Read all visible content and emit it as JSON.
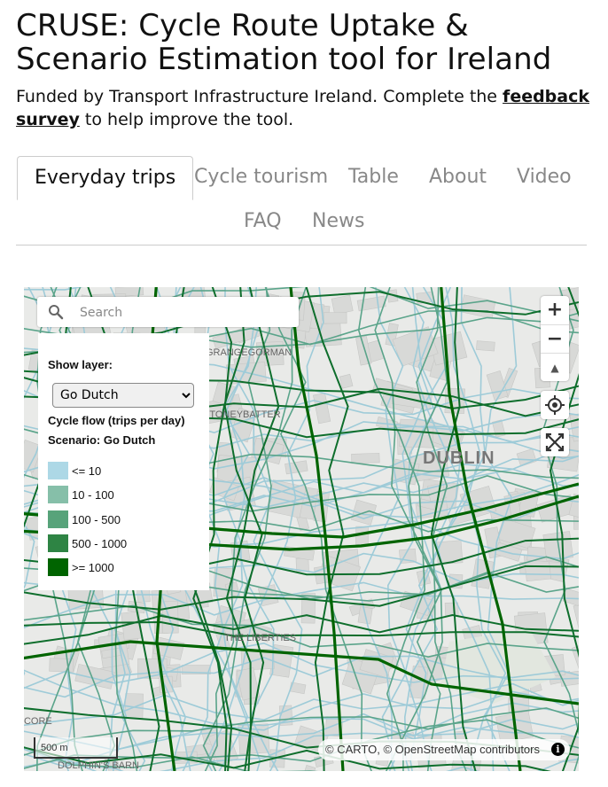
{
  "header": {
    "title": "CRUSE: Cycle Route Uptake & Scenario Estimation tool for Ireland",
    "subtitle_before": "Funded by Transport Infrastructure Ireland. Complete the ",
    "subtitle_link": "feedback survey",
    "subtitle_after": " to help improve the tool."
  },
  "tabs": [
    {
      "label": "Everyday trips",
      "active": true
    },
    {
      "label": "Cycle tourism",
      "active": false
    },
    {
      "label": "Table",
      "active": false
    },
    {
      "label": "About",
      "active": false
    },
    {
      "label": "Video",
      "active": false
    },
    {
      "label": "FAQ",
      "active": false
    },
    {
      "label": "News",
      "active": false
    }
  ],
  "map": {
    "search_placeholder": "Search",
    "legend": {
      "show_layer_label": "Show layer:",
      "layer_selected": "Go Dutch",
      "flow_title": "Cycle flow (trips per day)",
      "scenario_label": "Scenario: Go Dutch",
      "items": [
        {
          "label": "<= 10",
          "color": "#add8e6"
        },
        {
          "label": "10 - 100",
          "color": "#86bfa9"
        },
        {
          "label": "100 - 500",
          "color": "#57a37a"
        },
        {
          "label": "500 - 1000",
          "color": "#2e8444"
        },
        {
          "label": ">= 1000",
          "color": "#006400"
        }
      ]
    },
    "controls": {
      "zoom_in": "+",
      "zoom_out": "−",
      "compass": "▲",
      "locate": "◎",
      "fullscreen": "⤢"
    },
    "scale_label": "500 m",
    "attribution": "© CARTO, © OpenStreetMap contributors",
    "info": "i",
    "places": {
      "dublin": "DUBLIN",
      "liberties": "THE LIBERTIES",
      "harcourt": "HARCOURT",
      "dolphins_barn": "DOLPHIN'S BARN",
      "grangegorman": "GRANGEGORMAN",
      "stoneybatter": "STONEYBATTER",
      "inchicore": "INCHICORE"
    }
  }
}
